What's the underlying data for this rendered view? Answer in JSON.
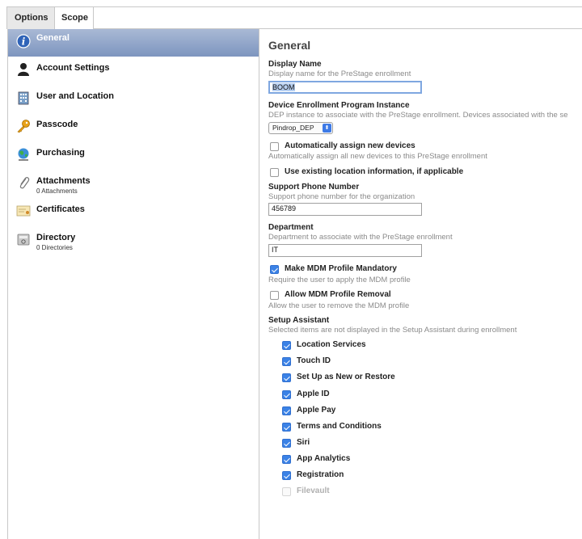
{
  "tabs": {
    "options": "Options",
    "scope": "Scope"
  },
  "sidebar": {
    "items": [
      {
        "label": "General",
        "sub": "",
        "icon": "info-icon",
        "active": true
      },
      {
        "label": "Account Settings",
        "sub": "",
        "icon": "user-icon"
      },
      {
        "label": "User and Location",
        "sub": "",
        "icon": "building-icon"
      },
      {
        "label": "Passcode",
        "sub": "",
        "icon": "key-icon"
      },
      {
        "label": "Purchasing",
        "sub": "",
        "icon": "globe-icon"
      },
      {
        "label": "Attachments",
        "sub": "0 Attachments",
        "icon": "paperclip-icon"
      },
      {
        "label": "Certificates",
        "sub": "",
        "icon": "certificate-icon"
      },
      {
        "label": "Directory",
        "sub": "0 Directories",
        "icon": "directory-icon"
      }
    ]
  },
  "main": {
    "heading": "General",
    "display_name": {
      "label": "Display Name",
      "desc": "Display name for the PreStage enrollment",
      "value": "BOOM"
    },
    "dep_instance": {
      "label": "Device Enrollment Program Instance",
      "desc": "DEP instance to associate with the PreStage enrollment. Devices associated with the se",
      "value": "Pindrop_DEP"
    },
    "auto_assign": {
      "label": "Automatically assign new devices",
      "desc": "Automatically assign all new devices to this PreStage enrollment",
      "checked": false
    },
    "existing_location": {
      "label": "Use existing location information, if applicable",
      "checked": false
    },
    "support_phone": {
      "label": "Support Phone Number",
      "desc": "Support phone number for the organization",
      "value": "456789"
    },
    "department": {
      "label": "Department",
      "desc": "Department to associate with the PreStage enrollment",
      "value": "IT"
    },
    "mdm_mandatory": {
      "label": "Make MDM Profile Mandatory",
      "desc": "Require the user to apply the MDM profile",
      "checked": true
    },
    "mdm_removal": {
      "label": "Allow MDM Profile Removal",
      "desc": "Allow the user to remove the MDM profile",
      "checked": false
    },
    "setup_assistant": {
      "label": "Setup Assistant",
      "desc": "Selected items are not displayed in the Setup Assistant during enrollment",
      "items": [
        {
          "label": "Location Services",
          "checked": true
        },
        {
          "label": "Touch ID",
          "checked": true
        },
        {
          "label": "Set Up as New or Restore",
          "checked": true
        },
        {
          "label": "Apple ID",
          "checked": true
        },
        {
          "label": "Apple Pay",
          "checked": true
        },
        {
          "label": "Terms and Conditions",
          "checked": true
        },
        {
          "label": "Siri",
          "checked": true
        },
        {
          "label": "App Analytics",
          "checked": true
        },
        {
          "label": "Registration",
          "checked": true
        },
        {
          "label": "Filevault",
          "checked": false,
          "disabled": true
        }
      ]
    }
  },
  "colors": {
    "accent": "#3b82e6",
    "sidebar_active": "#8fa3c9"
  }
}
